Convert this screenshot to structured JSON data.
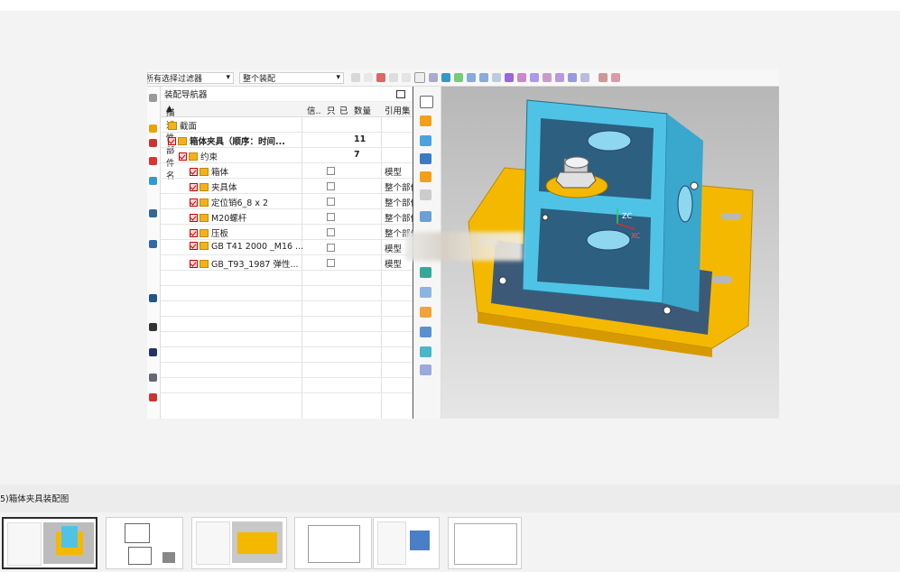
{
  "toolbar": {
    "filter_combo": "所有选择过滤器",
    "scope_combo": "整个装配"
  },
  "navigator": {
    "title": "装配导航器",
    "columns": {
      "name": "描述性部件名",
      "info": "信..",
      "c1": "只",
      "c2": "已",
      "qty": "数量",
      "ref": "引用集"
    },
    "rows": [
      {
        "name": "截面",
        "qty": "",
        "ref": "",
        "bold": false,
        "indent": 0
      },
      {
        "name": "箱体夹具（顺序：时间...",
        "qty": "11",
        "ref": "",
        "bold": true,
        "indent": 0
      },
      {
        "name": "约束",
        "qty": "7",
        "ref": "",
        "bold": false,
        "indent": 1
      },
      {
        "name": "箱体",
        "qty": "",
        "ref": "模型",
        "bold": false,
        "indent": 2
      },
      {
        "name": "夹具体",
        "qty": "",
        "ref": "整个部件",
        "bold": false,
        "indent": 2
      },
      {
        "name": "定位销6_8 x 2",
        "qty": "",
        "ref": "整个部件",
        "bold": false,
        "indent": 2
      },
      {
        "name": "M20螺杆",
        "qty": "",
        "ref": "整个部件",
        "bold": false,
        "indent": 2
      },
      {
        "name": "压板",
        "qty": "",
        "ref": "整个部件",
        "bold": false,
        "indent": 2
      },
      {
        "name": "GB T41 2000 _M16 ...",
        "qty": "",
        "ref": "模型",
        "bold": false,
        "indent": 2
      },
      {
        "name": "GB_T93_1987 弹性...",
        "qty": "",
        "ref": "模型",
        "bold": false,
        "indent": 2
      }
    ]
  },
  "viewport": {
    "axis_z": "ZC",
    "axis_x": "XC"
  },
  "caption": "5)箱体夹具装配图",
  "colors": {
    "fixture_base": "#f5b800",
    "box": "#4fc3e6",
    "accent": "#c00000"
  }
}
